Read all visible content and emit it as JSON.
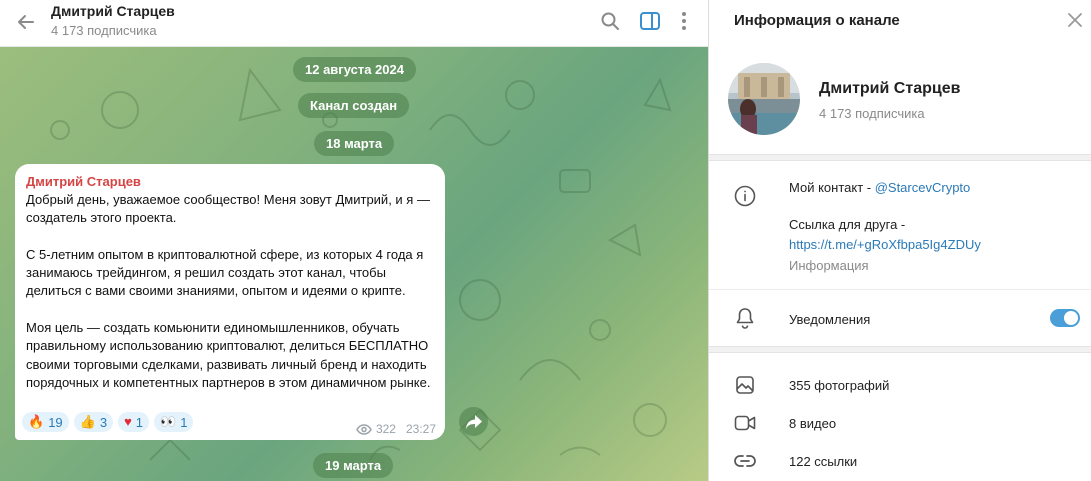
{
  "chat": {
    "header": {
      "title": "Дмитрий Старцев",
      "subscribers": "4 173 подписчика"
    },
    "dates": [
      "12 августа 2024",
      "Канал создан",
      "18 марта",
      "19 марта"
    ],
    "message": {
      "author": "Дмитрий Старцев",
      "text": "Добрый день, уважаемое сообщество! Меня зовут Дмитрий, и я — создатель этого проекта.\n\nС 5-летним опытом в криптовалютной сфере, из которых 4 года я занимаюсь трейдингом, я решил создать этот канал, чтобы делиться с вами своими знаниями, опытом и идеями о крипте.\n\nМоя цель — создать комьюнити единомышленников, обучать правильному использованию криптовалют, делиться БЕСПЛАТНО своими торговыми сделками, развивать личный бренд и находить порядочных и компетентных партнеров в этом динамичном рынке.",
      "reactions": [
        {
          "emoji": "🔥",
          "count": "19"
        },
        {
          "emoji": "👍",
          "count": "3"
        },
        {
          "emoji": "♥",
          "count": "1"
        },
        {
          "emoji": "👀",
          "count": "1"
        }
      ],
      "views": "322",
      "time": "23:27"
    }
  },
  "info": {
    "title": "Информация о канале",
    "name": "Дмитрий Старцев",
    "subscribers": "4 173 подписчика",
    "contact_prefix": "Мой контакт - ",
    "contact_handle": "@StarcevCrypto",
    "friend_link_label": "Ссылка для друга -",
    "friend_link_url": "https://t.me/+gRoXfbpa5Ig4ZDUy",
    "info_label": "Информация",
    "notifications_label": "Уведомления",
    "notifications_on": true,
    "media": {
      "photos": "355 фотографий",
      "videos": "8 видео",
      "links": "122 ссылки"
    }
  },
  "colors": {
    "accent": "#2a7ab8",
    "author": "#d64545",
    "toggle": "#4a9fd8"
  }
}
